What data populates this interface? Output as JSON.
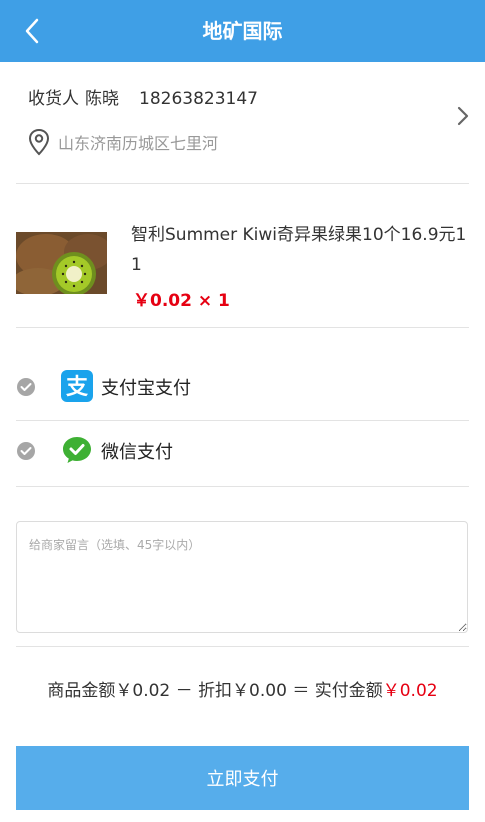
{
  "header": {
    "title": "地矿国际",
    "background": "#3f9fe6"
  },
  "address": {
    "receiver_label": "收货人",
    "receiver_name": "陈晓",
    "phone": "18263823147",
    "location": "山东济南历城区七里河"
  },
  "product": {
    "name": "智利Summer Kiwi奇异果绿果10个16.9元11",
    "price": "￥0.02 × 1"
  },
  "payment": {
    "options": [
      {
        "label": "支付宝支付",
        "icon": "alipay-icon"
      },
      {
        "label": "微信支付",
        "icon": "wechat-icon"
      }
    ]
  },
  "remark": {
    "placeholder": "给商家留言（选填、45字以内）"
  },
  "summary": {
    "goods_label": "商品金额",
    "goods_value": "￥0.02",
    "minus": "－",
    "discount_label": "折扣",
    "discount_value": "￥0.00",
    "equals": "＝",
    "total_label": "实付金额",
    "total_value": "￥0.02"
  },
  "submit": {
    "label": "立即支付"
  },
  "colors": {
    "accent": "#3f9fe6",
    "price_red": "#e60012",
    "alipay": "#1aa3ec",
    "wechat": "#3eb034"
  }
}
